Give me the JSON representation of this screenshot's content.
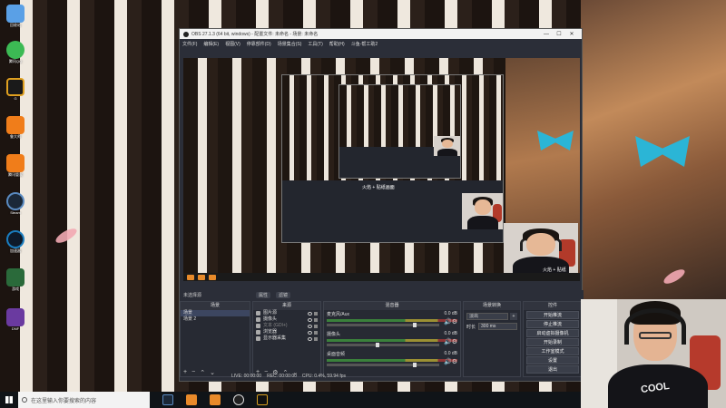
{
  "desktop": {
    "icons": [
      {
        "label": "回收站",
        "color": "#5aa0e6"
      },
      {
        "label": "腾讯QQ",
        "color": "#3cba54"
      },
      {
        "label": "G",
        "color": "#e0a020"
      },
      {
        "label": "鲁大师",
        "color": "#f07d1a"
      },
      {
        "label": "腾讯管家",
        "color": "#f07d1a"
      },
      {
        "label": "Steam",
        "color": "#1b2838"
      },
      {
        "label": "加速器",
        "color": "#1a7dbf"
      },
      {
        "label": "游戏",
        "color": "#2a6a3a"
      },
      {
        "label": "DNF",
        "color": "#6a3aa0"
      }
    ]
  },
  "obs": {
    "title": "OBS 27.1.3 (64 bit, windows) - 配置文件: 未命名 - 场景: 未命名",
    "menu": [
      "文件(F)",
      "编辑(E)",
      "视图(V)",
      "停靠部件(D)",
      "场景集合(S)",
      "工具(T)",
      "帮助(H)",
      "斗鱼-帮工助2"
    ],
    "preview_caption": "火焰 + 贴纸",
    "nested_caption": "火焰 + 贴纸画面",
    "source_bar": {
      "label": "未选择源",
      "properties": "属性",
      "filters": "滤镜"
    },
    "docks": {
      "scenes_title": "场景",
      "sources_title": "来源",
      "mixer_title": "混音器",
      "transitions_title": "场景转换",
      "controls_title": "控件"
    },
    "scenes": [
      "场景",
      "场景 2"
    ],
    "sources": [
      "图片源",
      "摄像头",
      "文本 (GDI+)",
      "浏览器",
      "显示器采集"
    ],
    "mixer": [
      {
        "name": "麦克风/Aux",
        "db": "0.0 dB",
        "fader": 0.78
      },
      {
        "name": "摄像头",
        "db": "0.0 dB",
        "fader": 0.45
      },
      {
        "name": "桌面音频",
        "db": "0.0 dB",
        "fader": 0.78
      }
    ],
    "transition": {
      "type": "淡出",
      "duration_label": "时长",
      "duration": "300 ms"
    },
    "controls": [
      "开始推流",
      "停止推流",
      "启动虚拟摄像机",
      "开始录制",
      "工作室模式",
      "设置",
      "退出"
    ],
    "status": {
      "live": "LIVE: 00:00:00",
      "rec": "REC: 00:00:00",
      "cpu": "CPU: 0.4%, 59.94 fps"
    }
  },
  "taskbar": {
    "search_placeholder": "在这里输入你要搜索的内容",
    "apps": [
      {
        "name": "steam",
        "color": "#1b2838"
      },
      {
        "name": "orange-app-1",
        "color": "#e88a2a"
      },
      {
        "name": "orange-app-2",
        "color": "#e88a2a"
      },
      {
        "name": "obs",
        "color": "#222222"
      },
      {
        "name": "g-app",
        "color": "#d9a020"
      }
    ]
  },
  "webcam": {
    "shirt_text": "COOL"
  }
}
